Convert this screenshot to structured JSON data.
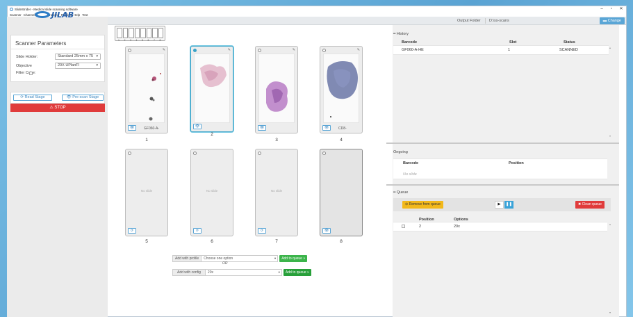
{
  "window": {
    "title": "SlideStrider - Medical slide scanning software",
    "controls": {
      "minimize": "–",
      "maximize": "▫",
      "close": "✕"
    }
  },
  "menu": [
    "Scanner",
    "Channels",
    "Configurations",
    "Profiles",
    "Help",
    "Test"
  ],
  "logo": {
    "text": "JILAB"
  },
  "output": {
    "label": "Output Folder",
    "path": "D:\\ss-scans",
    "change_label": "Change"
  },
  "scanner_params": {
    "title": "Scanner Parameters",
    "slide_holder": {
      "label": "Slide Holder:",
      "value": "Standard 25mm x 75"
    },
    "objective": {
      "label": "Objective",
      "value": "20X UPlanFl"
    },
    "filter_cube": {
      "label": "Filter Cube:"
    }
  },
  "actions": {
    "read_stage": "⟳ Read Stage",
    "pre_scan_stage": "👁 Pre-scan Stage",
    "stop": "⚠ STOP"
  },
  "tray": {
    "slot_labels": [
      "1",
      "2",
      "3",
      "4",
      "5",
      "6",
      "7",
      "8"
    ]
  },
  "slots": [
    {
      "number": "1",
      "barcode": "GF060-A-",
      "has_slide": true
    },
    {
      "number": "2",
      "barcode": "",
      "has_slide": true,
      "selected": true
    },
    {
      "number": "3",
      "barcode": "",
      "has_slide": true
    },
    {
      "number": "4",
      "barcode": "CD8-",
      "has_slide": true
    },
    {
      "number": "5",
      "empty_text": "No slide"
    },
    {
      "number": "6",
      "empty_text": "No slide"
    },
    {
      "number": "7",
      "empty_text": "No slide"
    },
    {
      "number": "8",
      "empty_text": ""
    }
  ],
  "add_profile": {
    "label": "Add with profile",
    "placeholder": "Choose one option",
    "button": "Add to queue »"
  },
  "or_text": "OR",
  "add_config": {
    "label": "Add with config",
    "value": "20x",
    "button": "Add to queue »"
  },
  "history": {
    "title": "History",
    "columns": [
      "Barcode",
      "Slot",
      "Status"
    ],
    "rows": [
      {
        "barcode": "GF060-A-HE",
        "slot": "1",
        "status": "SCANNED"
      }
    ]
  },
  "ongoing": {
    "title": "Ongoing",
    "columns": [
      "Barcode",
      "Position"
    ],
    "empty": "No slide"
  },
  "queue": {
    "title": "Queue",
    "remove_label": "Remove from queue",
    "play": "▶",
    "pause": "❚❚",
    "clear_label": "✖ Clean queue",
    "columns": [
      "Position",
      "Options"
    ],
    "rows": [
      {
        "position": "2",
        "options": "20x"
      }
    ]
  },
  "colors": {
    "accent": "#3aa3d8",
    "stop": "#e03b3b",
    "add": "#3bb44a",
    "remove": "#f2b81a"
  }
}
